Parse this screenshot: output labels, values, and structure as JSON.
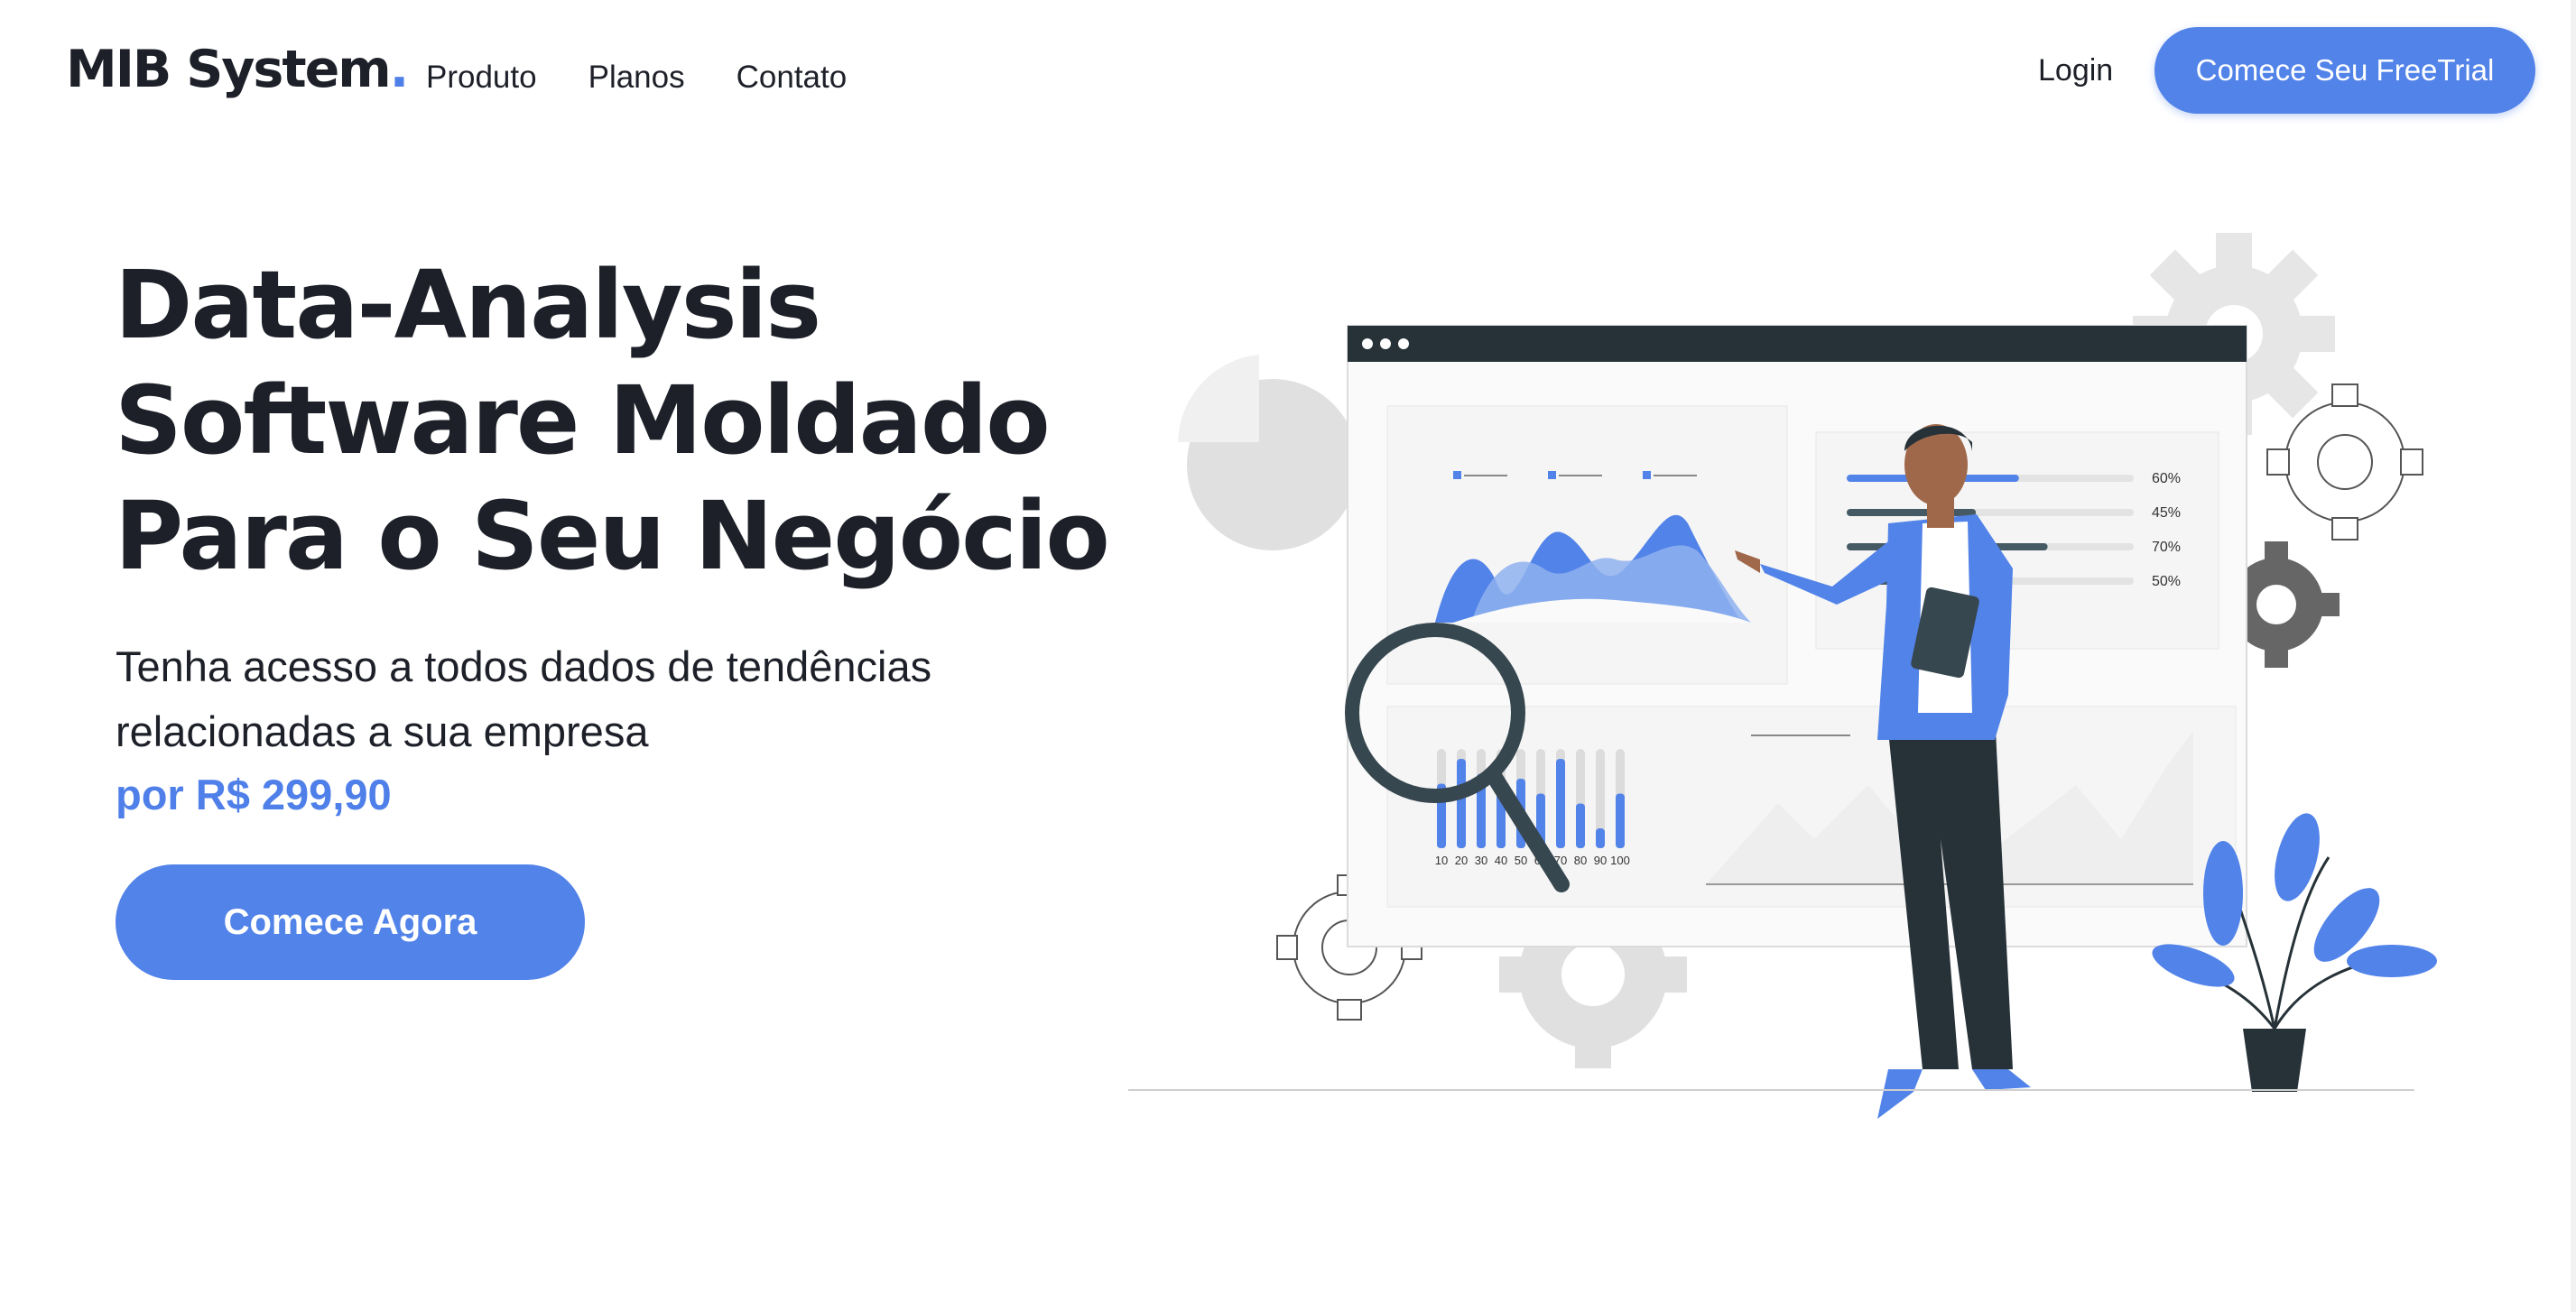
{
  "brand": {
    "name": "MIB System",
    "dot": "."
  },
  "nav": {
    "links": [
      "Produto",
      "Planos",
      "Contato"
    ],
    "login_label": "Login",
    "trial_label": "Comece Seu FreeTrial"
  },
  "hero": {
    "title_lines": [
      "Data-Analysis",
      "Software Moldado",
      "Para o Seu Negócio"
    ],
    "subtitle_lines": [
      "Tenha acesso a todos dados de tendências",
      "relacionadas a sua empresa"
    ],
    "price": "por R$ 299,90",
    "cta_label": "Comece Agora"
  },
  "illustration": {
    "progress_labels": [
      "60%",
      "45%",
      "70%",
      "50%"
    ],
    "progress_values": [
      0.6,
      0.45,
      0.7,
      0.5
    ],
    "bar_axis_labels": [
      "10",
      "20",
      "30",
      "40",
      "50",
      "60",
      "70",
      "80",
      "90",
      "100"
    ],
    "bar_values": [
      0.65,
      0.9,
      0.75,
      0.55,
      0.7,
      0.55,
      0.9,
      0.45,
      0.2,
      0.55
    ]
  },
  "colors": {
    "accent": "#5283e9",
    "text": "#1d2028",
    "dark": "#263238",
    "gear": "#e0e0e0"
  }
}
